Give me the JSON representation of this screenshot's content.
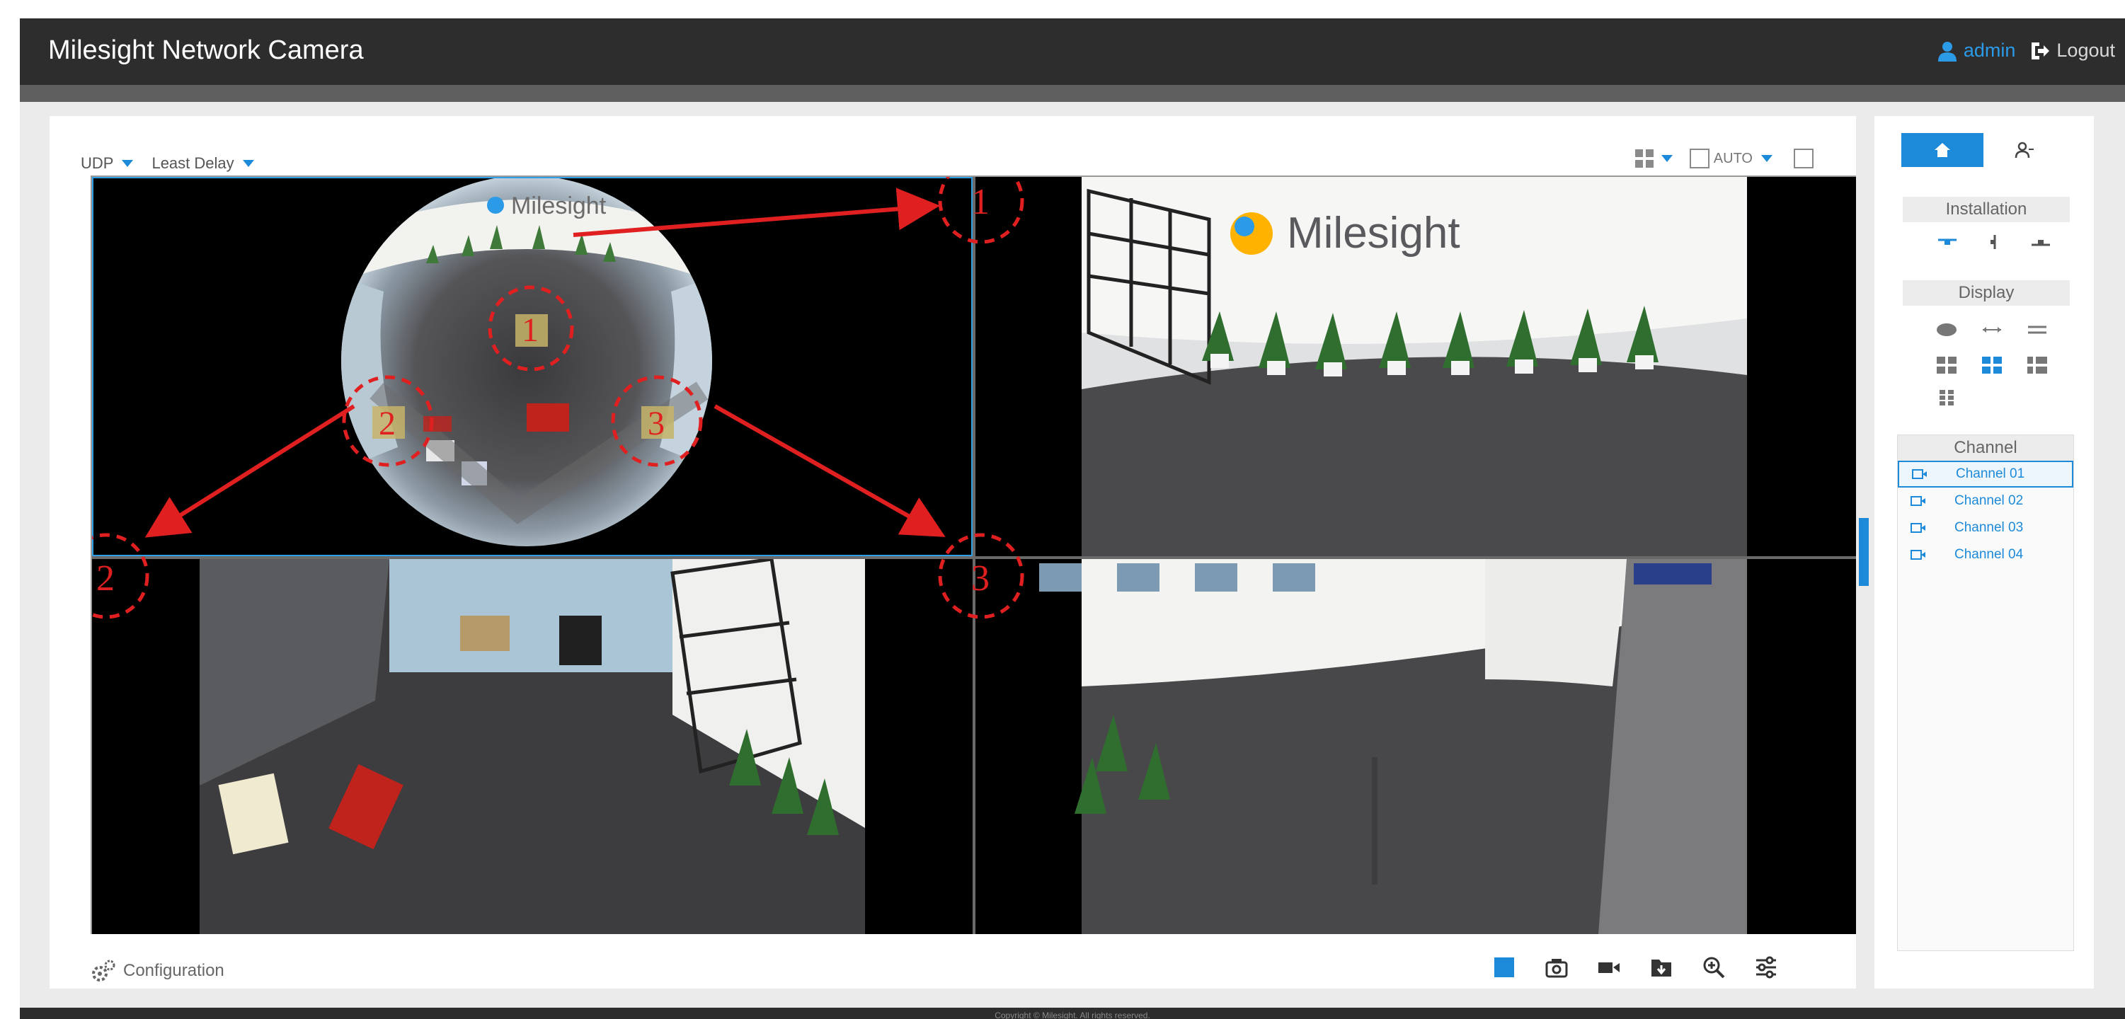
{
  "header": {
    "title": "Milesight Network Camera",
    "user": "admin",
    "logout": "Logout"
  },
  "toolbar": {
    "protocol": "UDP",
    "delay_mode": "Least Delay",
    "zoom_mode": "AUTO"
  },
  "fisheye_logo": "Milesight",
  "wall_logo": "Milesight",
  "annotations": {
    "one": "1",
    "two": "2",
    "three": "3"
  },
  "bottom": {
    "configuration": "Configuration"
  },
  "panel": {
    "installation": "Installation",
    "display": "Display",
    "channel": "Channel",
    "channels": [
      "Channel 01",
      "Channel 02",
      "Channel 03",
      "Channel 04"
    ]
  },
  "footer": {
    "copyright": "Copyright © Milesight. All rights reserved."
  },
  "colors": {
    "accent": "#1c8ad9",
    "header": "#2d2d2d",
    "annotation": "#e02020",
    "selected_border": "#2e9ee6"
  }
}
